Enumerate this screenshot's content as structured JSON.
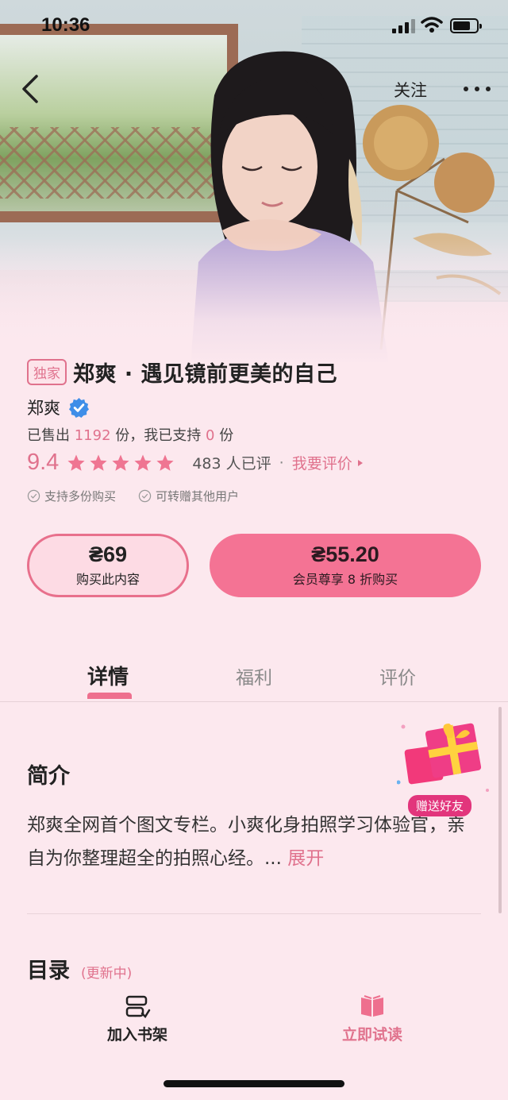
{
  "status_bar": {
    "time": "10:36"
  },
  "nav": {
    "follow_label": "关注"
  },
  "product": {
    "badge": "独家",
    "title": "郑爽 · 遇见镜前更美的自己",
    "author": "郑爽",
    "sold_prefix": "已售出",
    "sold_count": "1192",
    "sold_mid": "份，我已支持",
    "supported_count": "0",
    "sold_suffix": "份",
    "score": "9.4",
    "star_rating": 5,
    "review_count": "483 人已评",
    "separator": "·",
    "rate_link": "我要评价",
    "features": [
      "支持多份购买",
      "可转赠其他用户"
    ]
  },
  "buy": {
    "price": "₴69",
    "label": "购买此内容",
    "vip_price": "₴55.20",
    "vip_label": "会员尊享 8 折购买"
  },
  "tabs": [
    "详情",
    "福利",
    "评价"
  ],
  "intro": {
    "title": "简介",
    "text": "郑爽全网首个图文专栏。小爽化身拍照学习体验官，亲自为你整理超全的拍照心经。...",
    "expand": "展开"
  },
  "toc": {
    "title": "目录",
    "status": "(更新中)"
  },
  "gift": {
    "label": "赠送好友"
  },
  "bottom_bar": {
    "shelf_label": "加入书架",
    "read_label": "立即试读"
  },
  "colors": {
    "accent": "#e0728d",
    "vip_button": "#f47394",
    "background": "#fce8ee"
  }
}
